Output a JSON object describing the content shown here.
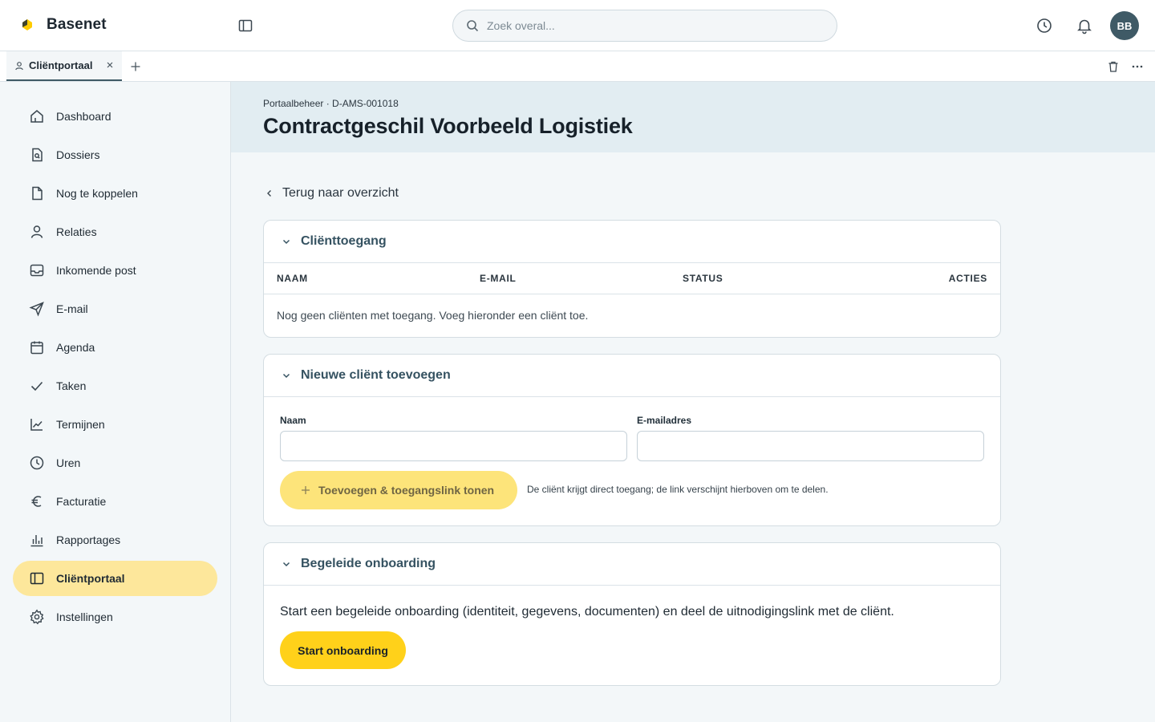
{
  "app": {
    "name": "Basenet"
  },
  "search": {
    "placeholder": "Zoek overal..."
  },
  "user": {
    "initials": "BB"
  },
  "tabs": [
    {
      "label": "Cliëntportaal"
    }
  ],
  "sidebar": {
    "items": [
      {
        "label": "Dashboard",
        "icon": "home-icon"
      },
      {
        "label": "Dossiers",
        "icon": "file-search-icon"
      },
      {
        "label": "Nog te koppelen",
        "icon": "file-icon"
      },
      {
        "label": "Relaties",
        "icon": "user-icon"
      },
      {
        "label": "Inkomende post",
        "icon": "inbox-icon"
      },
      {
        "label": "E-mail",
        "icon": "send-icon"
      },
      {
        "label": "Agenda",
        "icon": "calendar-icon"
      },
      {
        "label": "Taken",
        "icon": "check-icon"
      },
      {
        "label": "Termijnen",
        "icon": "line-chart-icon"
      },
      {
        "label": "Uren",
        "icon": "clock-icon"
      },
      {
        "label": "Facturatie",
        "icon": "euro-icon"
      },
      {
        "label": "Rapportages",
        "icon": "bar-chart-icon"
      },
      {
        "label": "Cliëntportaal",
        "icon": "panel-icon",
        "active": true
      },
      {
        "label": "Instellingen",
        "icon": "gear-icon"
      }
    ]
  },
  "header": {
    "breadcrumb": "Portaalbeheer · D-AMS-001018",
    "title": "Contractgeschil Voorbeeld Logistiek"
  },
  "main": {
    "back_label": "Terug naar overzicht",
    "access": {
      "title": "Cliënttoegang",
      "columns": [
        "NAAM",
        "E-MAIL",
        "STATUS",
        "ACTIES"
      ],
      "empty_text": "Nog geen cliënten met toegang. Voeg hieronder een cliënt toe."
    },
    "add_client": {
      "title": "Nieuwe cliënt toevoegen",
      "name_label": "Naam",
      "name_value": "",
      "email_label": "E-mailadres",
      "email_value": "",
      "button_label": "Toevoegen & toegangslink tonen",
      "hint": "De cliënt krijgt direct toegang; de link verschijnt hierboven om te delen."
    },
    "onboarding": {
      "title": "Begeleide onboarding",
      "text": "Start een begeleide onboarding (identiteit, gegevens, documenten) en deel de uitnodigingslink met de cliënt.",
      "button_label": "Start onboarding"
    }
  },
  "colors": {
    "accent": "#ffd11a",
    "accent_soft": "#fde79b",
    "avatar_bg": "#3f5a66",
    "card_title": "#355261",
    "header_band": "#e2edf2"
  }
}
